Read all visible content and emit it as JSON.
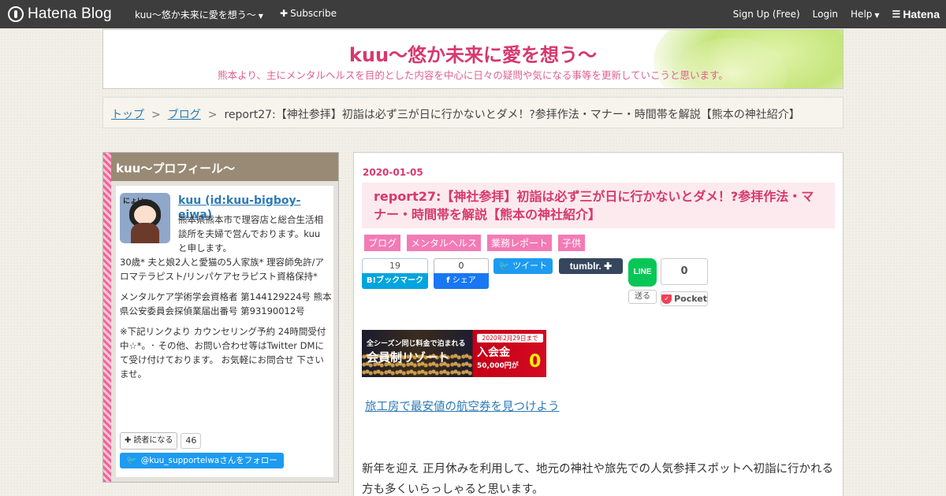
{
  "topbar": {
    "logo_text": "Hatena Blog",
    "blog_name": "kuu～悠か未来に愛を想う～",
    "subscribe": "Subscribe",
    "signup": "Sign Up (Free)",
    "login": "Login",
    "help": "Help",
    "hatena": "Hatena"
  },
  "header": {
    "title": "kuu～悠か未来に愛を想う～",
    "description": "熊本より、主にメンタルヘルスを目的とした内容を中心に日々の疑問や気になる事等を更新していこうと思います。"
  },
  "breadcrumb": {
    "items": [
      "トップ",
      "ブログ"
    ],
    "current": "report27:【神社参拝】初詣は必ず三が日に行かないとダメ！?参拝作法・マナー・時間帯を解説【熊本の神社紹介】",
    "separator": ">"
  },
  "sidebar": {
    "heading": "kuu～プロフィール～",
    "avatar_text": "にょい～",
    "name": "kuu (id:kuu-bigboy-eiwa)",
    "intro": "熊本県熊本市で理容店と総合生活相談所を夫婦で営んでおります。kuuと申します。",
    "paragraphs": [
      "30歳* 夫と娘2人と愛猫の5人家族* 理容師免許/アロマテラピスト/リンパケアセラピスト資格保持*",
      "メンタルケア学術学会資格者 第144129224号 熊本県公安委員会探偵業届出番号 第93190012号",
      "※下記リンクより カウンセリング予約 24時間受付中☆*。･ その他、お問い合わせ等はTwitter DMにて受け付けております。 お気軽にお問合せ 下さいませ。"
    ],
    "reader_button": "読者になる",
    "reader_count": "46",
    "twitter_follow": "@kuu_supporteiwaさんをフォロー"
  },
  "post": {
    "date": "2020-01-05",
    "title": "report27:【神社参拝】初詣は必ず三が日に行かないとダメ！?参拝作法・マナー・時間帯を解説【熊本の神社紹介】",
    "categories": [
      "ブログ",
      "メンタルヘルス",
      "業務レポート",
      "子供"
    ],
    "share": {
      "hatena_count": "19",
      "hatena_label": "B!ブックマーク",
      "facebook_count": "0",
      "facebook_label": "シェア",
      "tweet_label": "ツイート",
      "tumblr_label": "tumblr.",
      "line_label": "LINE",
      "line_send": "送る",
      "pocket_count": "0",
      "pocket_label": "Pocket"
    },
    "ad": {
      "line1": "全シーズン同じ料金で泊まれる",
      "line2": "会員制リゾート",
      "badge": "2020年2月29日まで",
      "fee_label": "入会金",
      "fee_was": "50,000円が",
      "fee_now": "0円"
    },
    "airline_link": "旅工房で最安値の航空券を見つけよう",
    "body": "新年を迎え 正月休みを利用して、地元の神社や旅先での人気参拝スポットへ初詣に行かれる方も多くいらっしゃると思います。"
  }
}
